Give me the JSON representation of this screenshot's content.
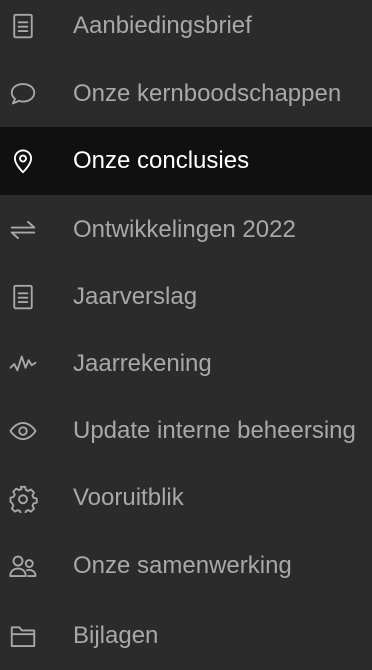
{
  "menu": {
    "active_index": 2,
    "items": [
      {
        "label": "Aanbiedingsbrief",
        "icon": "document-icon"
      },
      {
        "label": "Onze kernboodschappen",
        "icon": "speech-bubble-icon"
      },
      {
        "label": "Onze conclusies",
        "icon": "location-pin-icon"
      },
      {
        "label": "Ontwikkelingen 2022",
        "icon": "swap-arrows-icon"
      },
      {
        "label": "Jaarverslag",
        "icon": "document-icon"
      },
      {
        "label": "Jaarrekening",
        "icon": "activity-icon"
      },
      {
        "label": "Update interne beheersing",
        "icon": "eye-icon"
      },
      {
        "label": "Vooruitblik",
        "icon": "gear-icon"
      },
      {
        "label": "Onze samenwerking",
        "icon": "users-icon"
      },
      {
        "label": "Bijlagen",
        "icon": "folder-icon"
      }
    ]
  },
  "colors": {
    "background": "#2b2b2b",
    "active_background": "#101010",
    "text": "#a8a8a8",
    "active_text": "#ffffff"
  }
}
